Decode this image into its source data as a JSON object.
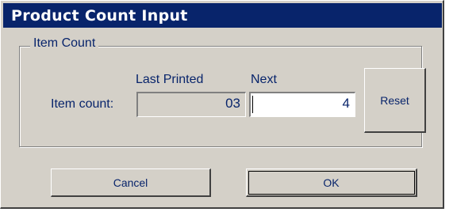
{
  "window": {
    "title": "Product Count Input"
  },
  "group": {
    "label": "Item Count",
    "row_label": "Item count:",
    "last_printed": {
      "header": "Last Printed",
      "value": "03"
    },
    "next": {
      "header": "Next",
      "value": "4"
    },
    "reset_label": "Reset"
  },
  "buttons": {
    "cancel_label": "Cancel",
    "ok_label": "OK"
  },
  "colors": {
    "titlebar": "#08246b",
    "face": "#d4d0c8",
    "text": "#08246b"
  }
}
